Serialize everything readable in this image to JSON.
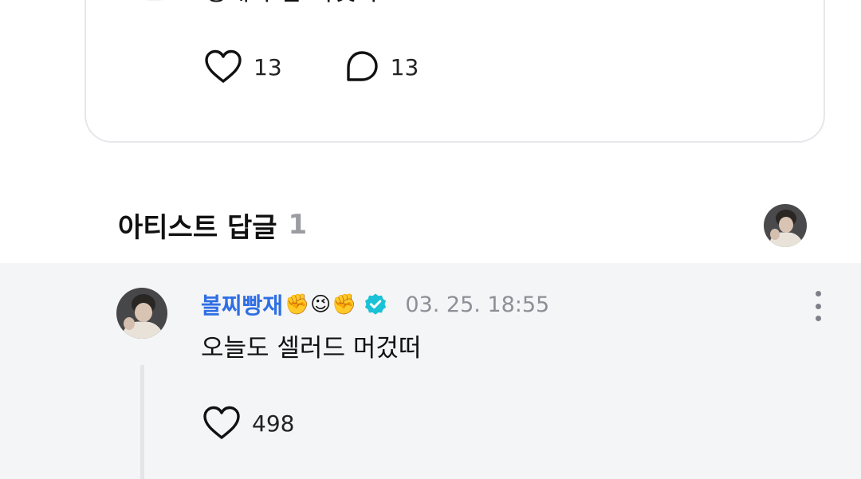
{
  "post": {
    "text": "영재야 밥 묵엇나.",
    "like_count": "13",
    "comment_count": "13"
  },
  "artist_replies": {
    "title": "아티스트 답글",
    "count": "1"
  },
  "reply": {
    "author": "볼찌빵재",
    "author_emoji": "✊😉✊",
    "verified": true,
    "timestamp": "03. 25. 18:55",
    "text": "오늘도 셀러드 머겄떠",
    "like_count": "498"
  },
  "icons": {
    "like": "heart-outline-icon",
    "comment": "speech-bubble-icon",
    "verified": "verified-badge-icon",
    "more": "more-vertical-icon"
  },
  "colors": {
    "author_name": "#2f6fe4",
    "verified_badge": "#19c2d6",
    "reply_panel_bg": "#f4f5f7",
    "timestamp": "#8c8f95",
    "section_count": "#9a9ca2"
  }
}
